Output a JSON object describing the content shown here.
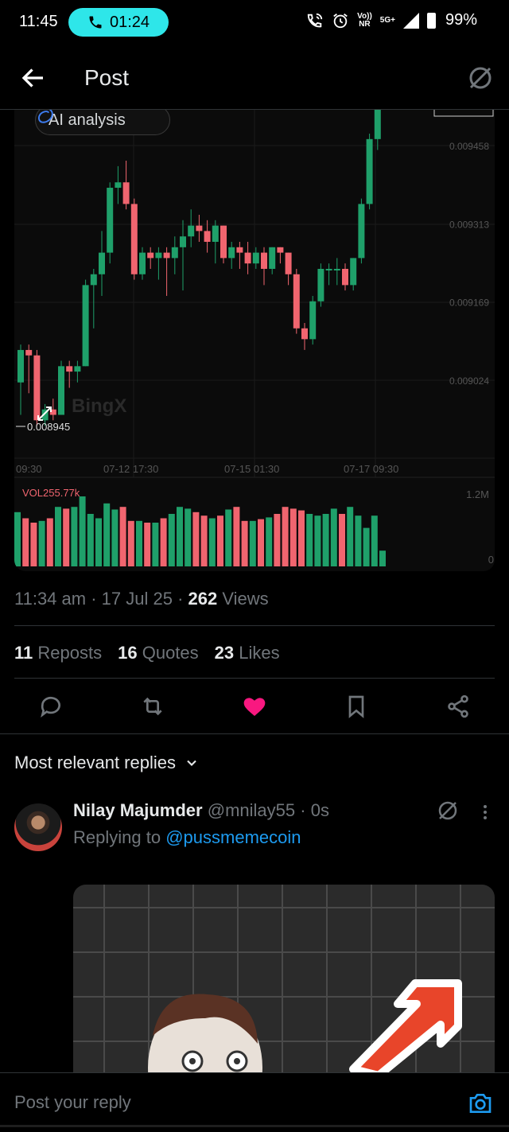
{
  "status_bar": {
    "time": "11:45",
    "call_timer": "01:24",
    "volte_label_top": "Vo))",
    "volte_label_bottom": "NR",
    "network": "5G+",
    "battery": "99%"
  },
  "header": {
    "title": "Post",
    "back_icon": "arrow-left-icon",
    "grok_icon": "grok-slash-icon"
  },
  "chart": {
    "ai_label": "AI analysis",
    "watermark": "BingX",
    "price_labels": [
      "0.009458",
      "0.009313",
      "0.009169",
      "0.009024"
    ],
    "low_label": "0.008945",
    "x_labels": [
      "09:30",
      "07-12 17:30",
      "07-15 01:30",
      "07-17 09:30"
    ],
    "vol_label": "VOL255.77k",
    "vol_max_label": "1.2M",
    "vol_min_label": "0",
    "colors": {
      "up": "#1fa06a",
      "down": "#f0656f",
      "vol_label": "#f0656f"
    }
  },
  "chart_data": {
    "type": "candlestick",
    "x_ticks": [
      "09:30",
      "07-12 17:30",
      "07-15 01:30",
      "07-17 09:30"
    ],
    "y_ticks": [
      0.009458,
      0.009313,
      0.009169,
      0.009024
    ],
    "lowest_marked": 0.008945,
    "candles": [
      {
        "o": 0.00902,
        "h": 0.00909,
        "l": 0.00896,
        "c": 0.00908
      },
      {
        "o": 0.00908,
        "h": 0.00909,
        "l": 0.009,
        "c": 0.00907
      },
      {
        "o": 0.00907,
        "h": 0.00908,
        "l": 0.00894,
        "c": 0.00895
      },
      {
        "o": 0.00895,
        "h": 0.00898,
        "l": 0.00894,
        "c": 0.00897
      },
      {
        "o": 0.00897,
        "h": 0.00899,
        "l": 0.00895,
        "c": 0.00896
      },
      {
        "o": 0.00896,
        "h": 0.00906,
        "l": 0.00896,
        "c": 0.00905
      },
      {
        "o": 0.00905,
        "h": 0.00906,
        "l": 0.00901,
        "c": 0.00904
      },
      {
        "o": 0.00904,
        "h": 0.00906,
        "l": 0.00902,
        "c": 0.00905
      },
      {
        "o": 0.00905,
        "h": 0.00921,
        "l": 0.00905,
        "c": 0.0092
      },
      {
        "o": 0.0092,
        "h": 0.00923,
        "l": 0.00912,
        "c": 0.00922
      },
      {
        "o": 0.00922,
        "h": 0.0093,
        "l": 0.00918,
        "c": 0.00926
      },
      {
        "o": 0.00926,
        "h": 0.00939,
        "l": 0.00924,
        "c": 0.00938
      },
      {
        "o": 0.00938,
        "h": 0.00942,
        "l": 0.00935,
        "c": 0.00939
      },
      {
        "o": 0.00939,
        "h": 0.00943,
        "l": 0.00934,
        "c": 0.00935
      },
      {
        "o": 0.00935,
        "h": 0.00936,
        "l": 0.00921,
        "c": 0.00922
      },
      {
        "o": 0.00922,
        "h": 0.00927,
        "l": 0.00921,
        "c": 0.00926
      },
      {
        "o": 0.00926,
        "h": 0.00927,
        "l": 0.00923,
        "c": 0.00925
      },
      {
        "o": 0.00925,
        "h": 0.00927,
        "l": 0.00921,
        "c": 0.00926
      },
      {
        "o": 0.00926,
        "h": 0.00927,
        "l": 0.00918,
        "c": 0.00925
      },
      {
        "o": 0.00925,
        "h": 0.00929,
        "l": 0.00922,
        "c": 0.00927
      },
      {
        "o": 0.00927,
        "h": 0.00932,
        "l": 0.00919,
        "c": 0.00929
      },
      {
        "o": 0.00929,
        "h": 0.00934,
        "l": 0.00927,
        "c": 0.00931
      },
      {
        "o": 0.00931,
        "h": 0.00933,
        "l": 0.00928,
        "c": 0.0093
      },
      {
        "o": 0.0093,
        "h": 0.00932,
        "l": 0.00926,
        "c": 0.00928
      },
      {
        "o": 0.00928,
        "h": 0.00932,
        "l": 0.00924,
        "c": 0.00931
      },
      {
        "o": 0.00931,
        "h": 0.00931,
        "l": 0.00924,
        "c": 0.00925
      },
      {
        "o": 0.00925,
        "h": 0.00928,
        "l": 0.00923,
        "c": 0.00927
      },
      {
        "o": 0.00927,
        "h": 0.00928,
        "l": 0.00923,
        "c": 0.00926
      },
      {
        "o": 0.00926,
        "h": 0.00928,
        "l": 0.00922,
        "c": 0.00924
      },
      {
        "o": 0.00924,
        "h": 0.00927,
        "l": 0.00923,
        "c": 0.00926
      },
      {
        "o": 0.00926,
        "h": 0.00927,
        "l": 0.0092,
        "c": 0.00923
      },
      {
        "o": 0.00923,
        "h": 0.00927,
        "l": 0.00922,
        "c": 0.00927
      },
      {
        "o": 0.00927,
        "h": 0.00927,
        "l": 0.00924,
        "c": 0.00926
      },
      {
        "o": 0.00926,
        "h": 0.00926,
        "l": 0.0092,
        "c": 0.00922
      },
      {
        "o": 0.00922,
        "h": 0.00923,
        "l": 0.00911,
        "c": 0.00912
      },
      {
        "o": 0.00912,
        "h": 0.00913,
        "l": 0.00908,
        "c": 0.0091
      },
      {
        "o": 0.0091,
        "h": 0.00918,
        "l": 0.00909,
        "c": 0.00917
      },
      {
        "o": 0.00917,
        "h": 0.00924,
        "l": 0.00916,
        "c": 0.00923
      },
      {
        "o": 0.00923,
        "h": 0.00924,
        "l": 0.0092,
        "c": 0.00923
      },
      {
        "o": 0.00923,
        "h": 0.00925,
        "l": 0.0092,
        "c": 0.00923
      },
      {
        "o": 0.00923,
        "h": 0.00924,
        "l": 0.00919,
        "c": 0.0092
      },
      {
        "o": 0.0092,
        "h": 0.00925,
        "l": 0.00919,
        "c": 0.00925
      },
      {
        "o": 0.00925,
        "h": 0.00936,
        "l": 0.00924,
        "c": 0.00935
      },
      {
        "o": 0.00935,
        "h": 0.00948,
        "l": 0.00934,
        "c": 0.00947
      },
      {
        "o": 0.00947,
        "h": 0.00957,
        "l": 0.00945,
        "c": 0.00956
      },
      {
        "o": 0.00956,
        "h": 0.00962,
        "l": 0.00954,
        "c": 0.00961
      }
    ],
    "volume_axis": [
      "1.2M",
      "0"
    ],
    "volume_label": "VOL255.77k",
    "volume": [
      0.62,
      0.55,
      0.5,
      0.52,
      0.55,
      0.68,
      0.66,
      0.68,
      0.8,
      0.6,
      0.55,
      0.72,
      0.65,
      0.68,
      0.52,
      0.52,
      0.5,
      0.5,
      0.55,
      0.6,
      0.68,
      0.66,
      0.62,
      0.58,
      0.55,
      0.58,
      0.65,
      0.68,
      0.52,
      0.52,
      0.54,
      0.56,
      0.6,
      0.68,
      0.66,
      0.64,
      0.6,
      0.58,
      0.6,
      0.66,
      0.6,
      0.68,
      0.58,
      0.44,
      0.58,
      0.18
    ],
    "grid": true
  },
  "post": {
    "time": "11:34 am",
    "date": "17 Jul 25",
    "views_count": "262",
    "views_label": "Views",
    "reposts_count": "11",
    "reposts_label": "Reposts",
    "quotes_count": "16",
    "quotes_label": "Quotes",
    "likes_count": "23",
    "likes_label": "Likes",
    "like_color": "#f91880"
  },
  "replies": {
    "sort_label": "Most relevant replies",
    "reply": {
      "name": "Nilay Majumder",
      "handle": "@mnilay55",
      "time": "0s",
      "replying_prefix": "Replying to",
      "replying_handle": "@pussmemecoin"
    }
  },
  "composer": {
    "placeholder": "Post your reply"
  }
}
